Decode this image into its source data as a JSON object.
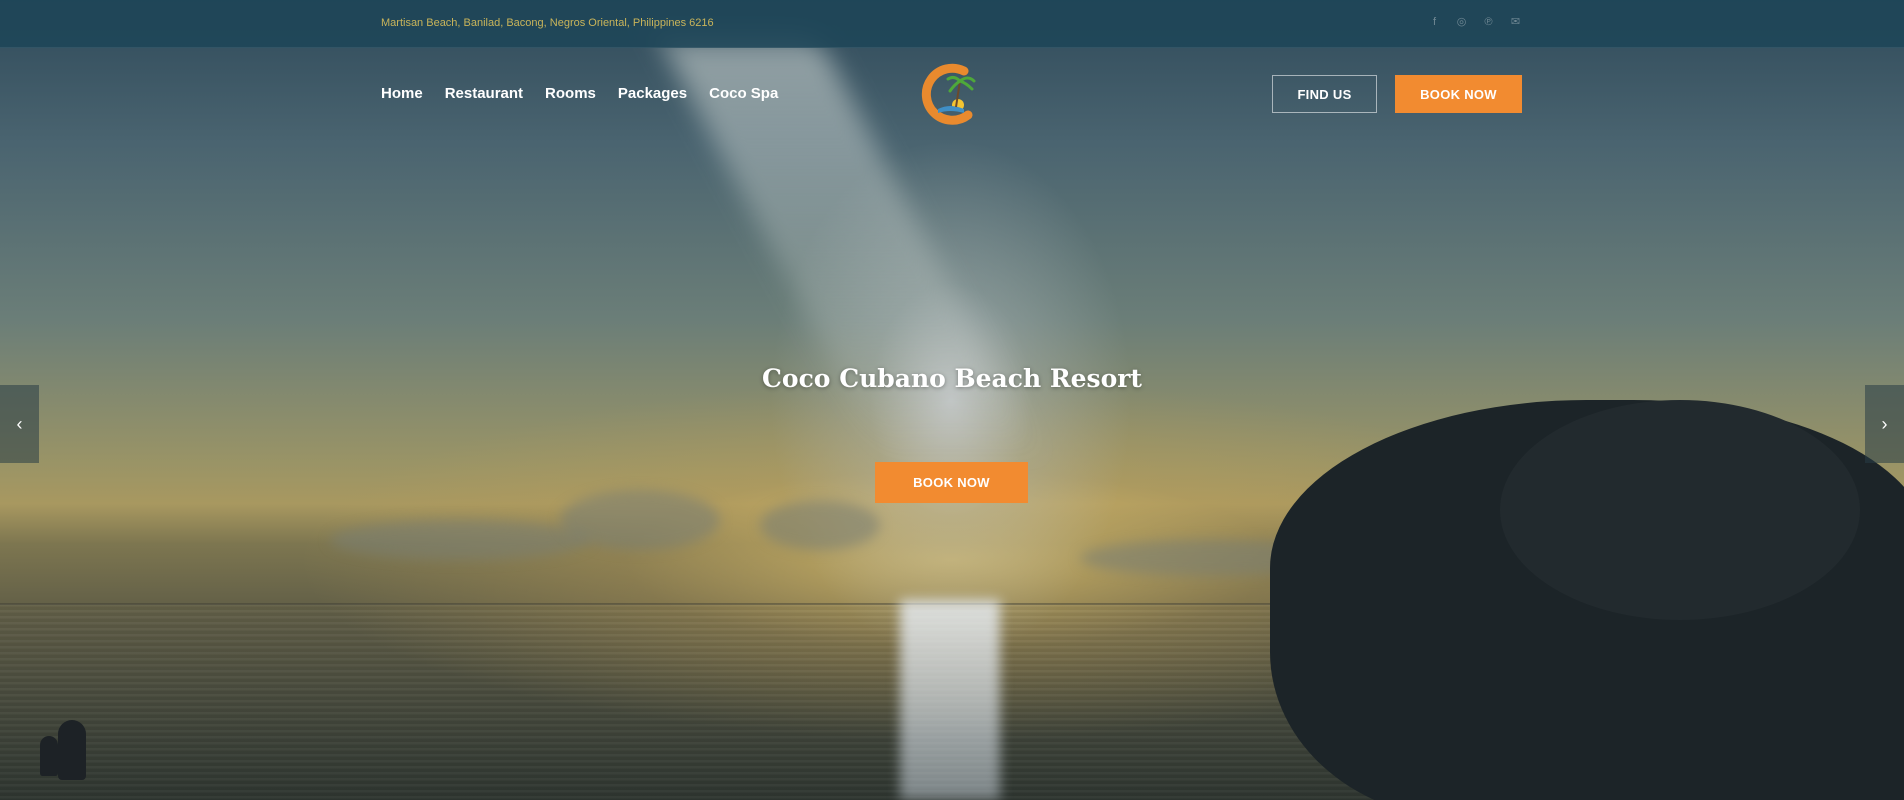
{
  "topbar": {
    "address": "Martisan Beach, Banilad, Bacong, Negros Oriental, Philippines 6216",
    "socials": [
      {
        "icon": "facebook-icon",
        "glyph": "f"
      },
      {
        "icon": "instagram-icon",
        "glyph": "◎"
      },
      {
        "icon": "pinterest-icon",
        "glyph": "℗"
      },
      {
        "icon": "mail-icon",
        "glyph": "✉"
      }
    ]
  },
  "nav": {
    "items": [
      "Home",
      "Restaurant",
      "Rooms",
      "Packages",
      "Coco Spa"
    ]
  },
  "header": {
    "find_us_label": "FIND US",
    "book_now_label": "BOOK NOW"
  },
  "hero": {
    "title": "Coco Cubano Beach Resort",
    "book_now_label": "BOOK NOW",
    "prev_glyph": "‹",
    "next_glyph": "›"
  },
  "colors": {
    "accent": "#f28b30",
    "topbar": "#1e4658",
    "address_text": "#c9b45a"
  }
}
